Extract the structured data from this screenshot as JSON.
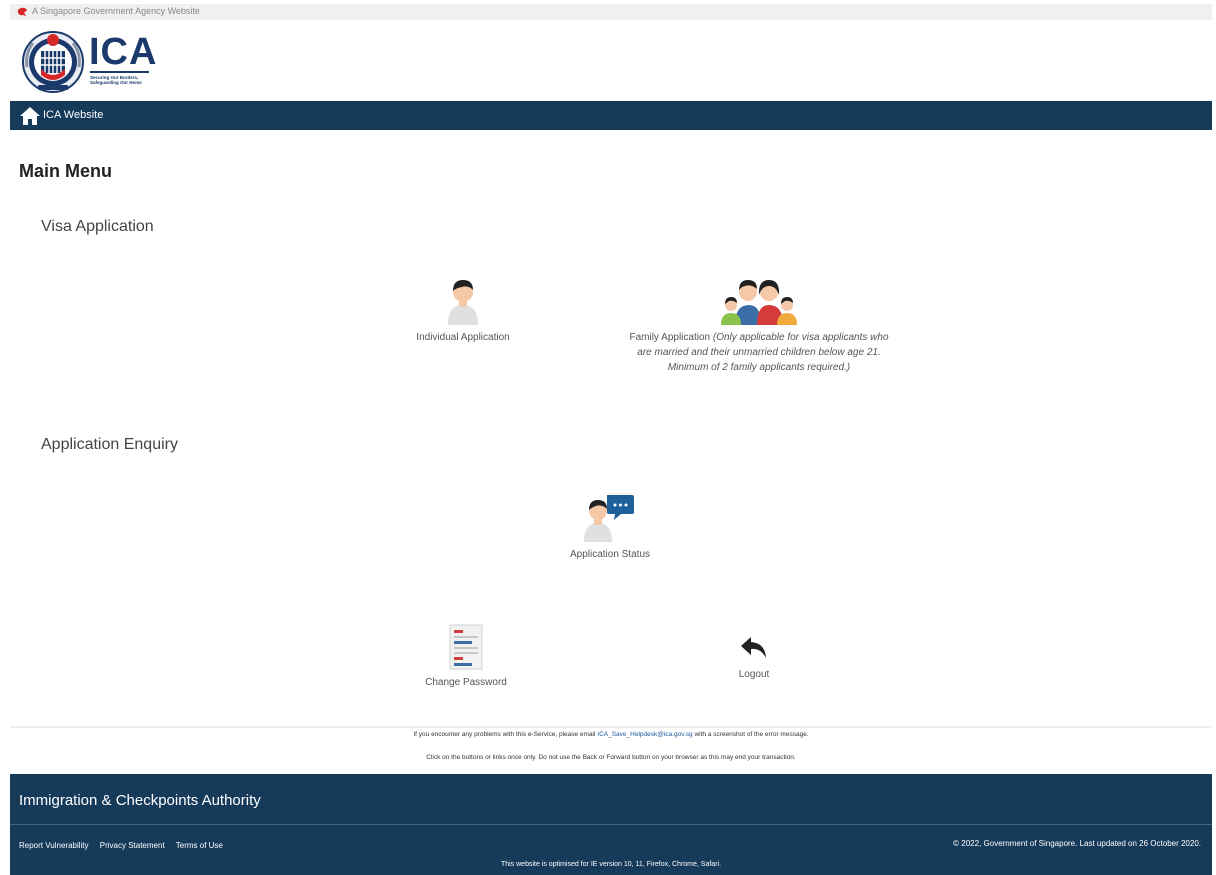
{
  "gov_banner": {
    "text": "A Singapore Government Agency Website",
    "icon": "lion-head-icon"
  },
  "logo": {
    "acronym": "ICA",
    "tagline_line1": "Securing Our Borders,",
    "tagline_line2": "Safeguarding Our Home",
    "colors": {
      "navy": "#1b3a6b",
      "red": "#d62828"
    }
  },
  "navbar": {
    "home_icon": "home-icon",
    "link_label": "ICA Website",
    "color": "#163a5a"
  },
  "main": {
    "title": "Main Menu",
    "visa_section": {
      "title": "Visa Application",
      "tiles": [
        {
          "icon": "person-icon",
          "label": "Individual Application"
        },
        {
          "icon": "family-icon",
          "label": "Family Application",
          "note": "(Only applicable for visa applicants who are married and their unmarried children below age 21. Minimum of 2 family applicants required.)"
        }
      ]
    },
    "enquiry_section": {
      "title": "Application Enquiry",
      "tiles": [
        {
          "icon": "person-chat-icon",
          "label": "Application Status"
        }
      ]
    },
    "actions": [
      {
        "icon": "document-icon",
        "label": "Change Password"
      },
      {
        "icon": "reply-arrow-icon",
        "label": "Logout"
      }
    ]
  },
  "footer_messages": {
    "problem_prefix": "If you encounter any problems with this e-Service, please email ",
    "problem_email": "ICA_Save_Helpdesk@ica.gov.sg",
    "problem_suffix": " with a screenshot of the error message.",
    "click_notice": "Click on the buttons or links once only. Do not use the Back or Forward button on your browser as this may end your transaction."
  },
  "footer": {
    "org_name": "Immigration & Checkpoints Authority",
    "links": [
      "Report Vulnerability",
      "Privacy Statement",
      "Terms of Use"
    ],
    "copyright": "© 2022, Government of Singapore. Last updated on 26 October 2020.",
    "optimised": "This website is optimised for IE version 10, 11, Firefox, Chrome, Safari."
  }
}
